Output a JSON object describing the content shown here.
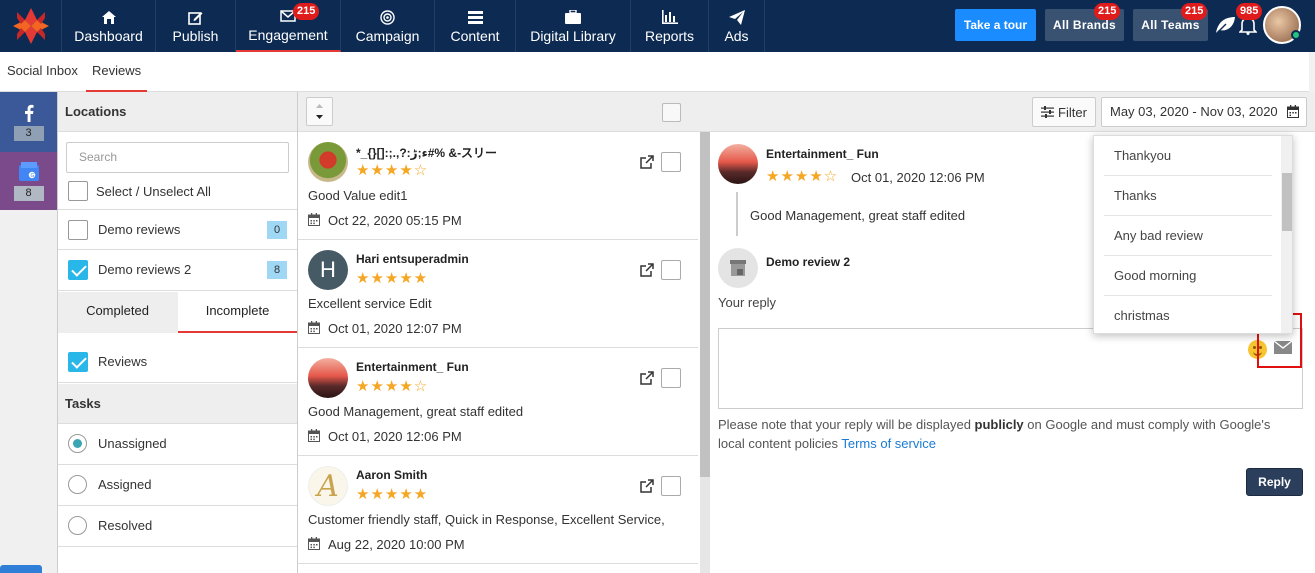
{
  "nav": {
    "items": [
      {
        "label": "Dashboard",
        "icon": "home-icon"
      },
      {
        "label": "Publish",
        "icon": "edit-icon"
      },
      {
        "label": "Engagement",
        "icon": "envelope-icon",
        "badge": "215",
        "active": true
      },
      {
        "label": "Campaign",
        "icon": "target-icon"
      },
      {
        "label": "Content",
        "icon": "list-icon"
      },
      {
        "label": "Digital Library",
        "icon": "briefcase-icon"
      },
      {
        "label": "Reports",
        "icon": "bar-chart-icon"
      },
      {
        "label": "Ads",
        "icon": "paper-plane-icon"
      }
    ],
    "take_tour": "Take a tour",
    "all_brands": "All Brands",
    "all_brands_badge": "215",
    "all_teams": "All Teams",
    "all_teams_badge": "215",
    "notifications_badge": "985"
  },
  "subnav": {
    "tabs": [
      "Social Inbox",
      "Reviews"
    ],
    "active": "Reviews"
  },
  "rail": {
    "facebook_count": "3",
    "google_count": "8"
  },
  "filters": {
    "locations_title": "Locations",
    "search_placeholder": "Search",
    "select_all": "Select / Unselect All",
    "locations": [
      {
        "label": "Demo reviews",
        "count": "0",
        "checked": false
      },
      {
        "label": "Demo reviews 2",
        "count": "8",
        "checked": true
      }
    ],
    "status_tabs": [
      "Completed",
      "Incomplete"
    ],
    "status_active": "Incomplete",
    "reviews_label": "Reviews",
    "tasks_title": "Tasks",
    "tasks": [
      {
        "label": "Unassigned",
        "checked": true
      },
      {
        "label": "Assigned",
        "checked": false
      },
      {
        "label": "Resolved",
        "checked": false
      }
    ]
  },
  "toolbar": {
    "filter_label": "Filter",
    "date_range": "May 03, 2020 - Nov 03, 2020"
  },
  "reviews": [
    {
      "name": "*_{}[]:;.,?:ء;ڑ#% &-スリー",
      "rating": 4,
      "text": "Good Value edit1",
      "date": "Oct 22, 2020 05:15 PM",
      "avatar": "rose"
    },
    {
      "name": "Hari entsuperadmin",
      "rating": 5,
      "text": "Excellent service Edit",
      "date": "Oct 01, 2020 12:07 PM",
      "avatar": "H"
    },
    {
      "name": "Entertainment_ Fun",
      "rating": 4,
      "text": "Good Management, great staff edited",
      "date": "Oct 01, 2020 12:06 PM",
      "avatar": "sunset"
    },
    {
      "name": "Aaron Smith",
      "rating": 5,
      "text": "Customer friendly staff, Quick in Response, Excellent Service,",
      "date": "Aug 22, 2020 10:00 PM",
      "avatar": "A"
    }
  ],
  "detail": {
    "reviewer": "Entertainment_ Fun",
    "rating": 4,
    "date": "Oct 01, 2020 12:06 PM",
    "text": "Good Management, great staff edited",
    "business": "Demo review 2",
    "your_reply": "Your reply",
    "note_pre": "Please note that your reply will be displayed ",
    "note_bold": "publicly",
    "note_mid": " on Google and must comply with Google's local content policies ",
    "note_link": "Terms of service",
    "reply_button": "Reply"
  },
  "templates": [
    "Thankyou",
    "Thanks",
    "Any bad review",
    "Good morning",
    "christmas"
  ],
  "colors": {
    "nav_bg": "#0d2b52",
    "accent": "#e53935",
    "tour": "#1a8cff",
    "star": "#f5a623",
    "check": "#29b6e8"
  }
}
